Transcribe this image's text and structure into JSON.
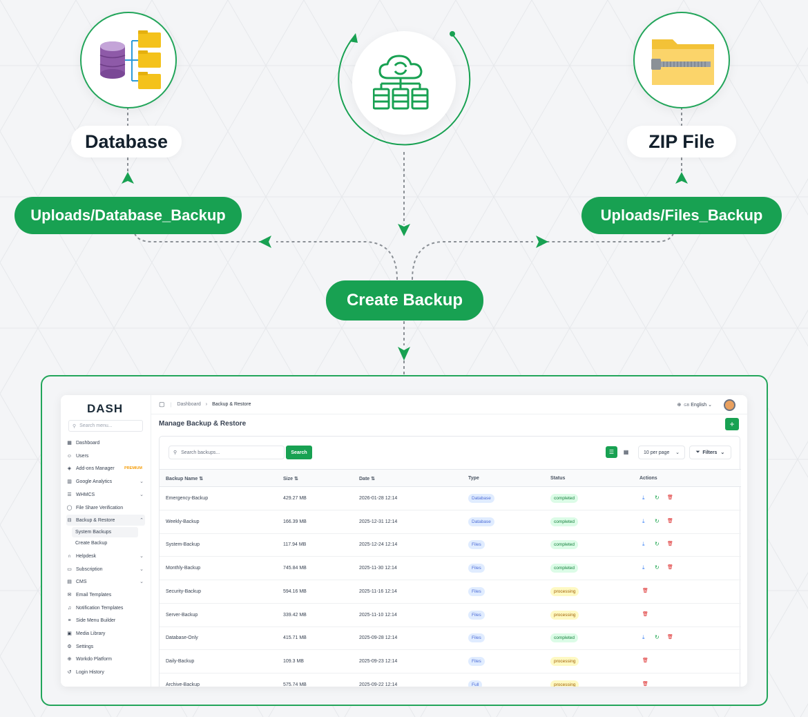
{
  "diagram": {
    "nodes": {
      "database": "Database",
      "zip": "ZIP File",
      "db_path": "Uploads/Database_Backup",
      "files_path": "Uploads/Files_Backup",
      "create": "Create Backup"
    },
    "icons": {
      "database": "database-folders-icon",
      "cloud": "cloud-sync-server-icon",
      "zip": "zip-folder-icon"
    },
    "colors": {
      "accent": "#18a152",
      "dark": "#13202c"
    }
  },
  "app": {
    "logo": "DASH",
    "sidebar": {
      "search_placeholder": "Search menu...",
      "items": [
        {
          "label": "Dashboard",
          "icon": "grid-icon"
        },
        {
          "label": "Users",
          "icon": "users-icon"
        },
        {
          "label": "Add-ons Manager",
          "icon": "box-icon",
          "badge": "PREMIUM"
        },
        {
          "label": "Google Analytics",
          "icon": "chart-icon",
          "chevron": true
        },
        {
          "label": "WHMCS",
          "icon": "server-icon",
          "chevron": true
        },
        {
          "label": "File Share Verification",
          "icon": "shield-icon"
        },
        {
          "label": "Backup & Restore",
          "icon": "database-icon",
          "chevron": true,
          "expanded": true
        },
        {
          "label": "Helpdesk",
          "icon": "headset-icon",
          "chevron": true
        },
        {
          "label": "Subscription",
          "icon": "card-icon",
          "chevron": true
        },
        {
          "label": "CMS",
          "icon": "layout-icon",
          "chevron": true
        },
        {
          "label": "Email Templates",
          "icon": "mail-icon"
        },
        {
          "label": "Notification Templates",
          "icon": "bell-icon"
        },
        {
          "label": "Side Menu Builder",
          "icon": "menu-icon"
        },
        {
          "label": "Media Library",
          "icon": "image-icon"
        },
        {
          "label": "Settings",
          "icon": "gear-icon"
        },
        {
          "label": "Workdo Platform",
          "icon": "globe-icon"
        },
        {
          "label": "Login History",
          "icon": "history-icon"
        }
      ],
      "sub_items": [
        "System Backups",
        "Create Backup"
      ]
    },
    "breadcrumb": {
      "home": "Dashboard",
      "current": "Backup & Restore"
    },
    "language": {
      "flag": "GB",
      "label": "English"
    },
    "page_title": "Manage Backup & Restore",
    "toolbar": {
      "search_placeholder": "Search backups...",
      "search_button": "Search",
      "per_page": "10 per page",
      "filters": "Filters"
    },
    "table": {
      "headers": [
        "Backup Name",
        "Size",
        "Date",
        "Type",
        "Status",
        "Actions"
      ],
      "rows": [
        {
          "name": "Emergency-Backup",
          "size": "429.27 MB",
          "date": "2026-01-28 12:14",
          "type": "Database",
          "status": "completed"
        },
        {
          "name": "Weekly-Backup",
          "size": "166.39 MB",
          "date": "2025-12-31 12:14",
          "type": "Database",
          "status": "completed"
        },
        {
          "name": "System-Backup",
          "size": "117.94 MB",
          "date": "2025-12-24 12:14",
          "type": "Files",
          "status": "completed"
        },
        {
          "name": "Monthly-Backup",
          "size": "745.84 MB",
          "date": "2025-11-30 12:14",
          "type": "Files",
          "status": "completed"
        },
        {
          "name": "Security-Backup",
          "size": "594.16 MB",
          "date": "2025-11-16 12:14",
          "type": "Files",
          "status": "processing"
        },
        {
          "name": "Server-Backup",
          "size": "339.42 MB",
          "date": "2025-11-10 12:14",
          "type": "Files",
          "status": "processing"
        },
        {
          "name": "Database-Only",
          "size": "415.71 MB",
          "date": "2025-09-28 12:14",
          "type": "Files",
          "status": "completed"
        },
        {
          "name": "Daily-Backup",
          "size": "109.3 MB",
          "date": "2025-09-23 12:14",
          "type": "Files",
          "status": "processing"
        },
        {
          "name": "Archive-Backup",
          "size": "575.74 MB",
          "date": "2025-09-22 12:14",
          "type": "Full",
          "status": "processing"
        }
      ]
    }
  }
}
